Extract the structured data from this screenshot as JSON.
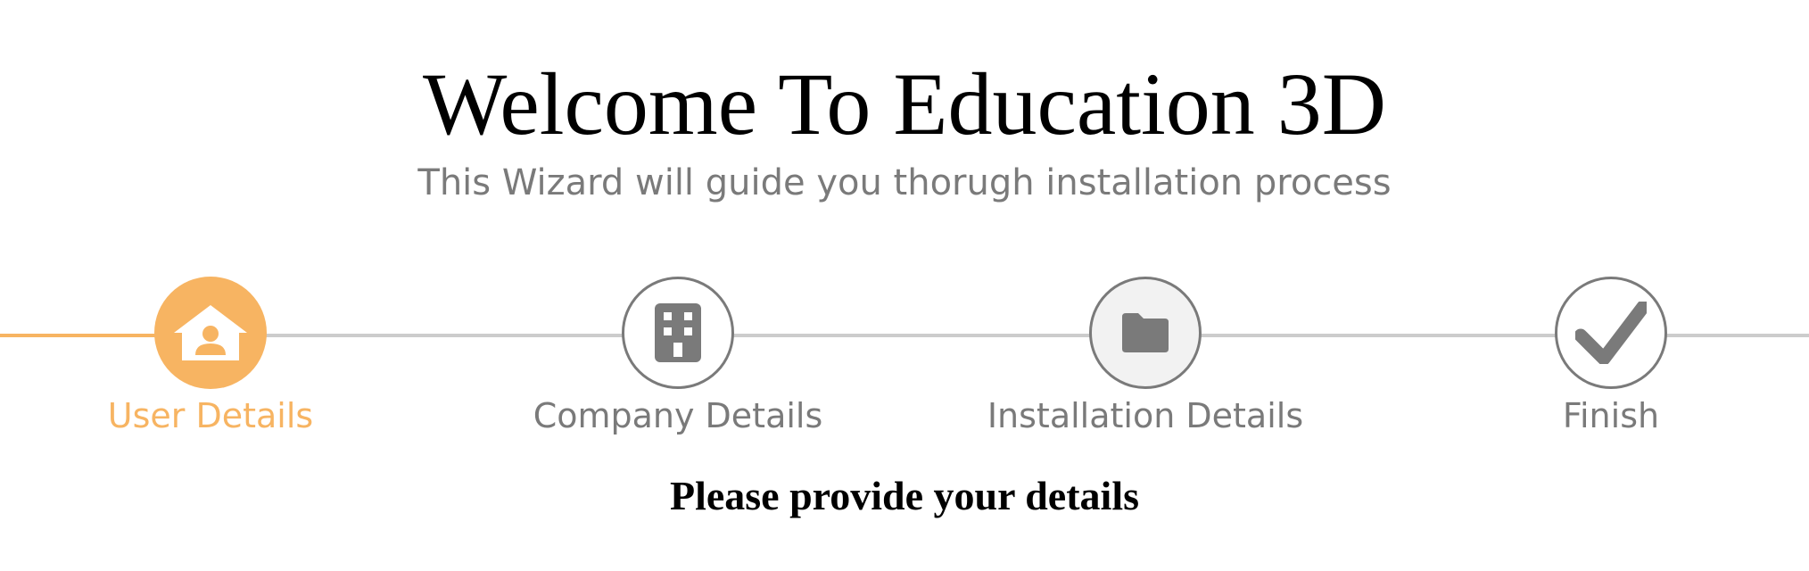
{
  "header": {
    "title": "Welcome To Education 3D",
    "subtitle": "This Wizard will guide you thorugh installation process"
  },
  "wizard": {
    "steps": [
      {
        "label": "User Details",
        "icon": "user-home-icon",
        "state": "active"
      },
      {
        "label": "Company Details",
        "icon": "building-icon",
        "state": "pending"
      },
      {
        "label": "Installation Details",
        "icon": "folder-icon",
        "state": "pending"
      },
      {
        "label": "Finish",
        "icon": "checkmark-icon",
        "state": "pending"
      }
    ]
  },
  "main": {
    "prompt": "Please provide your details"
  },
  "colors": {
    "accent": "#f7b462",
    "inactive": "#7a7a7a",
    "track": "#cccccc"
  }
}
